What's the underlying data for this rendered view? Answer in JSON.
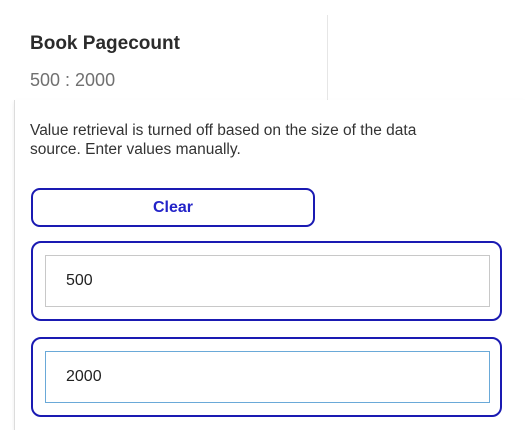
{
  "filter": {
    "title": "Book Pagecount",
    "range_display": "500 : 2000"
  },
  "popup": {
    "notice": "Value retrieval is turned off based on the size of the data source. Enter values manually.",
    "clear_label": "Clear",
    "min_value": "500",
    "max_value": "2000"
  },
  "colors": {
    "accent_border": "#1a1ab2",
    "button_text": "#2323c8",
    "focus_border": "#6aa9d8"
  }
}
